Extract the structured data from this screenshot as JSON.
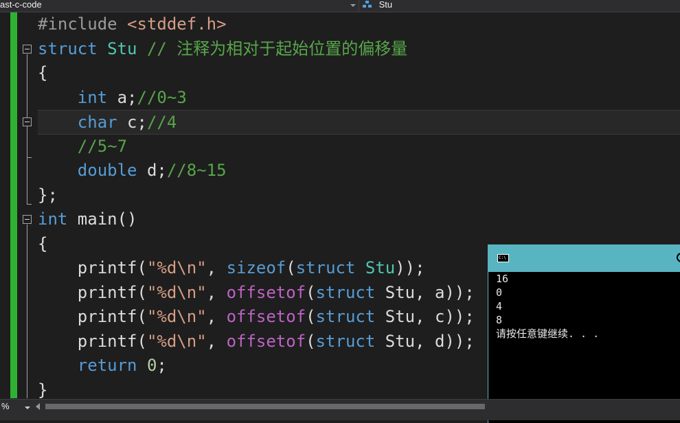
{
  "navbar": {
    "project": "ast-c-code",
    "scope": "Stu"
  },
  "editor": {
    "code_lines": [
      [
        {
          "c": "pp",
          "t": "#include "
        },
        {
          "c": "st",
          "t": "<stddef.h>"
        }
      ],
      [
        {
          "c": "kw",
          "t": "struct "
        },
        {
          "c": "ty",
          "t": "Stu "
        },
        {
          "c": "cm",
          "t": "// 注释为相对于起始位置的偏移量"
        }
      ],
      [
        {
          "c": "",
          "t": "{"
        }
      ],
      [
        {
          "c": "",
          "t": "    "
        },
        {
          "c": "kw",
          "t": "int"
        },
        {
          "c": "",
          "t": " a;"
        },
        {
          "c": "cm",
          "t": "//0~3"
        }
      ],
      [
        {
          "c": "",
          "t": "    "
        },
        {
          "c": "kw",
          "t": "char"
        },
        {
          "c": "",
          "t": " c;"
        },
        {
          "c": "cm",
          "t": "//4"
        }
      ],
      [
        {
          "c": "",
          "t": "    "
        },
        {
          "c": "cm",
          "t": "//5~7"
        }
      ],
      [
        {
          "c": "",
          "t": "    "
        },
        {
          "c": "kw",
          "t": "double"
        },
        {
          "c": "",
          "t": " d;"
        },
        {
          "c": "cm",
          "t": "//8~15"
        }
      ],
      [
        {
          "c": "",
          "t": "};"
        }
      ],
      [
        {
          "c": "kw",
          "t": "int"
        },
        {
          "c": "",
          "t": " main()"
        }
      ],
      [
        {
          "c": "",
          "t": "{"
        }
      ],
      [
        {
          "c": "",
          "t": "    printf("
        },
        {
          "c": "st",
          "t": "\"%d\\n\""
        },
        {
          "c": "",
          "t": ", "
        },
        {
          "c": "kw",
          "t": "sizeof"
        },
        {
          "c": "",
          "t": "("
        },
        {
          "c": "kw",
          "t": "struct"
        },
        {
          "c": "",
          "t": " "
        },
        {
          "c": "ty",
          "t": "Stu"
        },
        {
          "c": "",
          "t": "));"
        }
      ],
      [
        {
          "c": "",
          "t": "    printf("
        },
        {
          "c": "st",
          "t": "\"%d\\n\""
        },
        {
          "c": "",
          "t": ", "
        },
        {
          "c": "mc",
          "t": "offsetof"
        },
        {
          "c": "",
          "t": "("
        },
        {
          "c": "kw",
          "t": "struct"
        },
        {
          "c": "",
          "t": " Stu, a));"
        }
      ],
      [
        {
          "c": "",
          "t": "    printf("
        },
        {
          "c": "st",
          "t": "\"%d\\n\""
        },
        {
          "c": "",
          "t": ", "
        },
        {
          "c": "mc",
          "t": "offsetof"
        },
        {
          "c": "",
          "t": "("
        },
        {
          "c": "kw",
          "t": "struct"
        },
        {
          "c": "",
          "t": " Stu, c));"
        }
      ],
      [
        {
          "c": "",
          "t": "    printf("
        },
        {
          "c": "st",
          "t": "\"%d\\n\""
        },
        {
          "c": "",
          "t": ", "
        },
        {
          "c": "mc",
          "t": "offsetof"
        },
        {
          "c": "",
          "t": "("
        },
        {
          "c": "kw",
          "t": "struct"
        },
        {
          "c": "",
          "t": " Stu, d));"
        }
      ],
      [
        {
          "c": "",
          "t": "    "
        },
        {
          "c": "kw",
          "t": "return"
        },
        {
          "c": "",
          "t": " "
        },
        {
          "c": "nu",
          "t": "0"
        },
        {
          "c": "",
          "t": ";"
        }
      ],
      [
        {
          "c": "",
          "t": "}"
        }
      ]
    ],
    "current_line": 5
  },
  "status": {
    "zoom": "%"
  },
  "console": {
    "icon_text": "C:\\",
    "output": [
      "16",
      "0",
      "4",
      "8",
      "请按任意键继续. . ."
    ]
  },
  "colors": {
    "editor_bg": "#1e1e1e",
    "keyword": "#569cd6",
    "type": "#4ec9b0",
    "comment": "#57a64a",
    "string": "#d69d85",
    "macro": "#bd63c5",
    "change_bar": "#2fb133",
    "console_title": "#59b4c2"
  }
}
